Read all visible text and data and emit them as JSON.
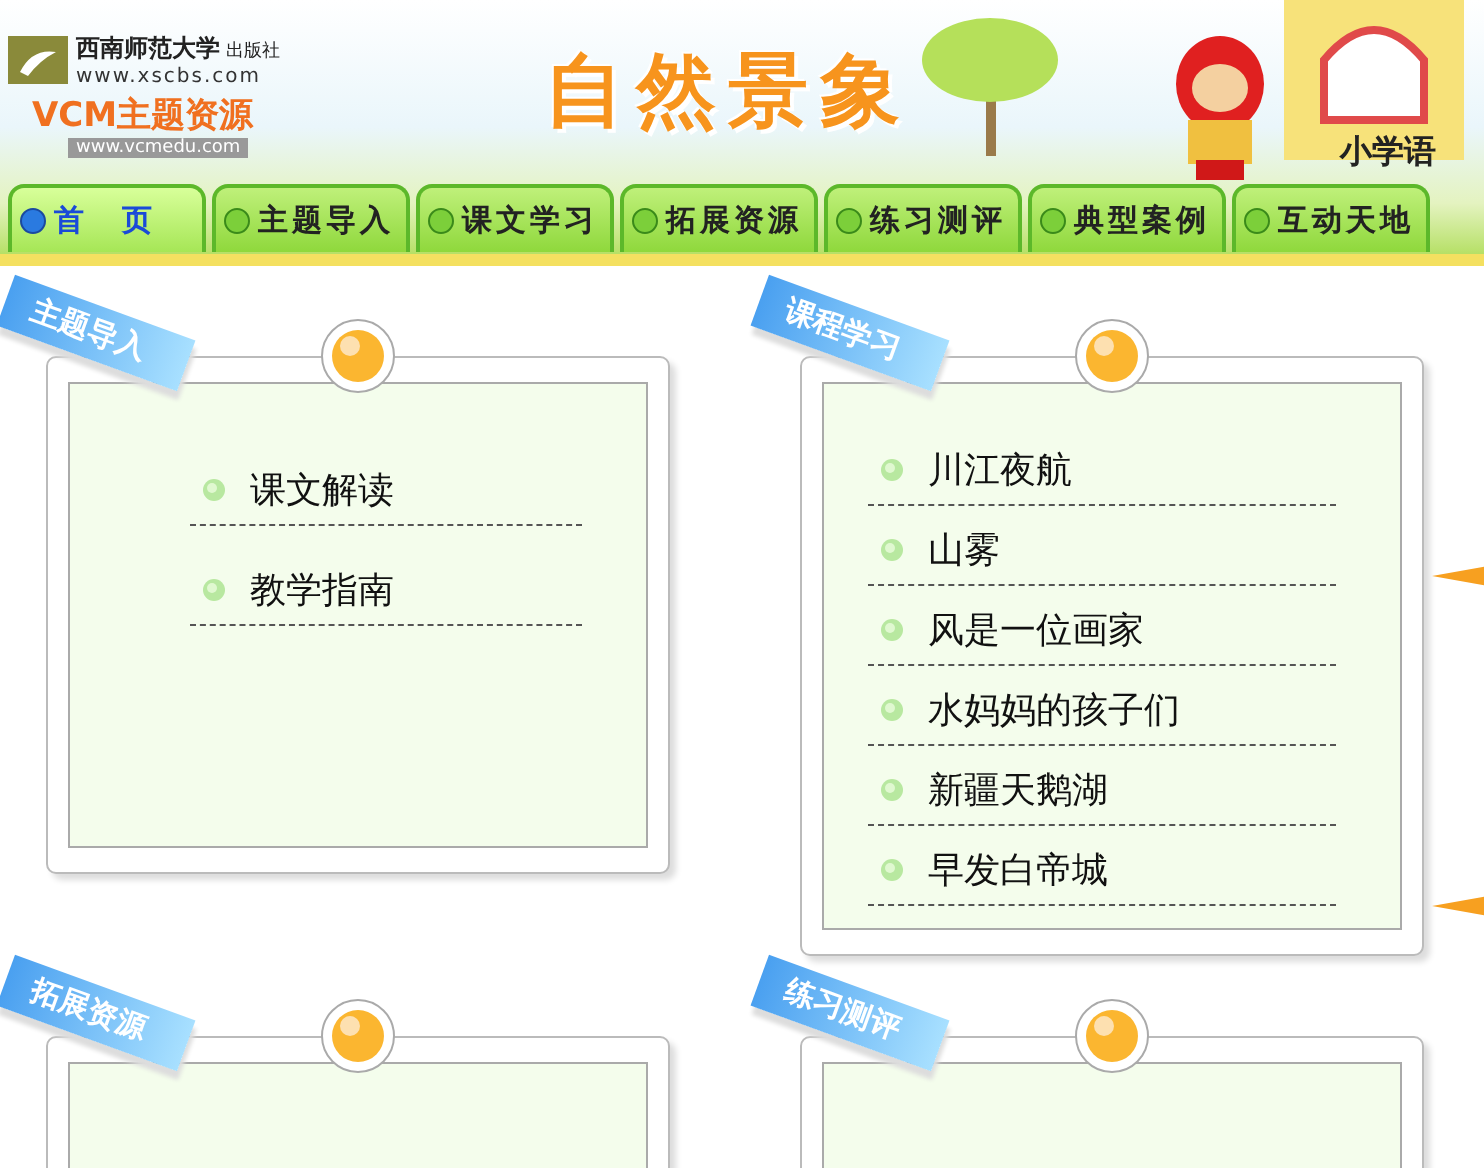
{
  "header": {
    "publisher_logo": {
      "name": "西南师范大学",
      "suffix": "出版社",
      "url": "www.xscbs.com"
    },
    "brand_logo": {
      "name": "VCM主题资源",
      "url": "www.vcmedu.com"
    },
    "title": "自然景象",
    "subject": "小学语"
  },
  "nav": [
    {
      "label": "首　页",
      "selected": true
    },
    {
      "label": "主题导入",
      "selected": false
    },
    {
      "label": "课文学习",
      "selected": false
    },
    {
      "label": "拓展资源",
      "selected": false
    },
    {
      "label": "练习测评",
      "selected": false
    },
    {
      "label": "典型案例",
      "selected": false
    },
    {
      "label": "互动天地",
      "selected": false
    }
  ],
  "panels": [
    {
      "tag": "主题导入",
      "items": [
        "课文解读",
        "教学指南"
      ]
    },
    {
      "tag": "课程学习",
      "items": [
        "川江夜航",
        "山雾",
        "风是一位画家",
        "水妈妈的孩子们",
        "新疆天鹅湖",
        "早发白帝城"
      ]
    },
    {
      "tag": "拓展资源"
    },
    {
      "tag": "练习测评"
    }
  ]
}
